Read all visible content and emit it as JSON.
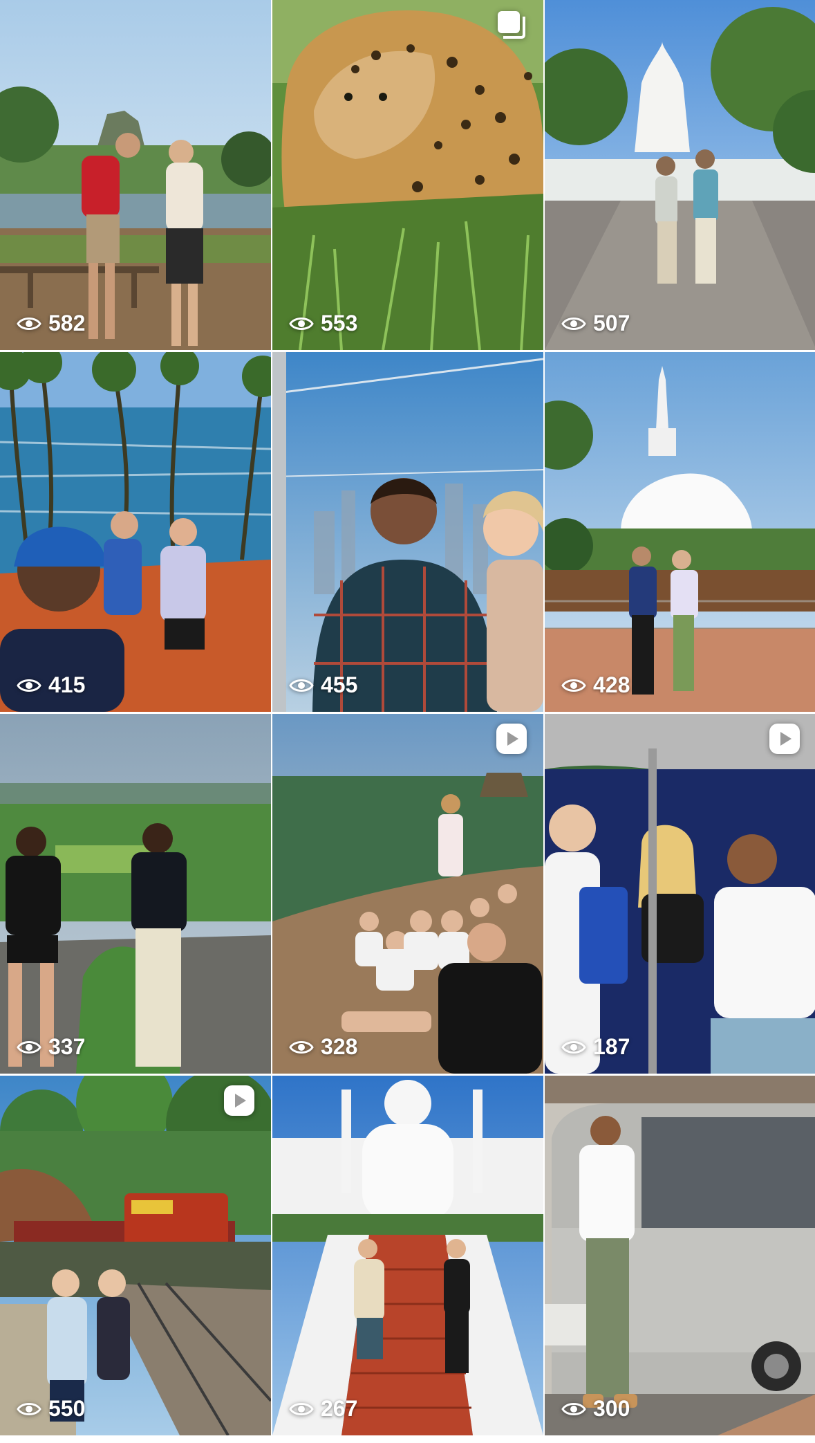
{
  "grid": {
    "tiles": [
      {
        "views": "582",
        "type": "photo",
        "scene": "couple by lake with rock fortress"
      },
      {
        "views": "553",
        "type": "carousel",
        "scene": "leopard in grass"
      },
      {
        "views": "507",
        "type": "photo",
        "scene": "two men at white stupa path"
      },
      {
        "views": "415",
        "type": "photo",
        "scene": "selfie with palm trees and ocean"
      },
      {
        "views": "455",
        "type": "photo",
        "scene": "selfie on cable car"
      },
      {
        "views": "428",
        "type": "photo",
        "scene": "couple at large white stupa"
      },
      {
        "views": "337",
        "type": "photo",
        "scene": "two men overlooking green valley"
      },
      {
        "views": "328",
        "type": "reel",
        "scene": "group sitting on rock at sunrise"
      },
      {
        "views": "187",
        "type": "reel",
        "scene": "friends in tuk tuk"
      },
      {
        "views": "550",
        "type": "reel",
        "scene": "women by train on railway bridge"
      },
      {
        "views": "267",
        "type": "photo",
        "scene": "women on stairs at white buddha statue"
      },
      {
        "views": "300",
        "type": "photo",
        "scene": "man standing by silver van"
      }
    ]
  },
  "icons": {
    "views": "eye-icon",
    "carousel": "carousel-icon",
    "reel": "reel-play-icon"
  },
  "colors": {
    "overlay_text": "#ffffff",
    "background": "#ffffff"
  }
}
